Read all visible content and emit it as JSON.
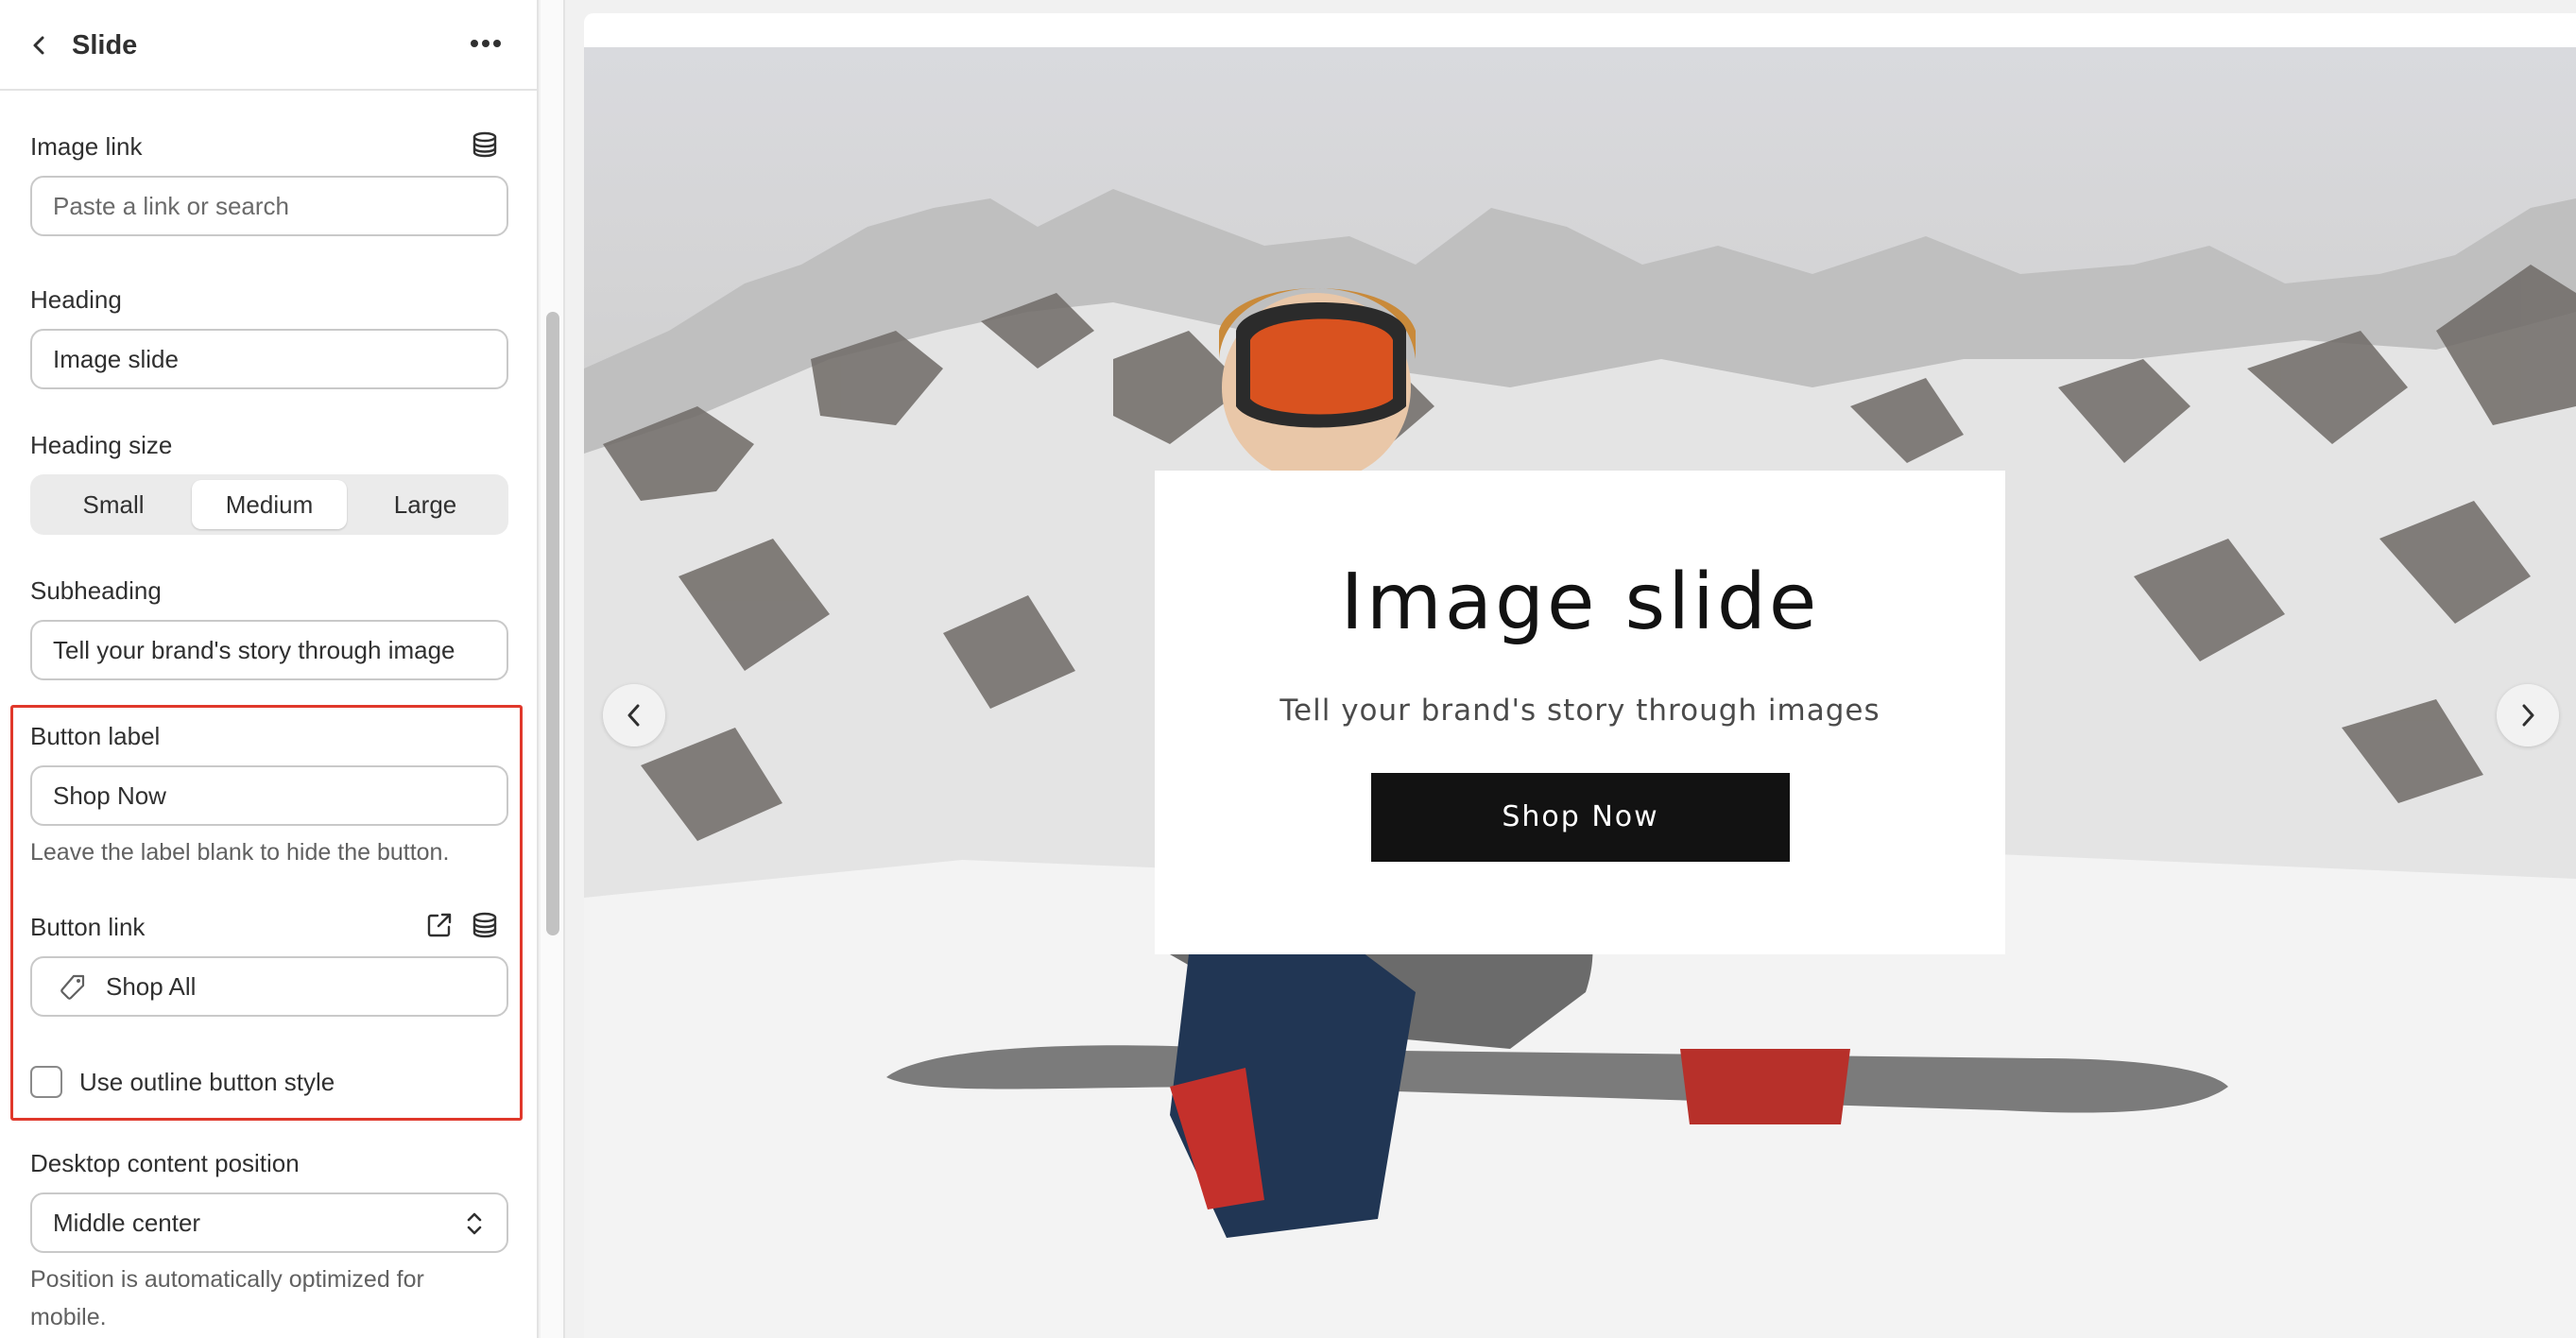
{
  "sidebar": {
    "title": "Slide",
    "image_link": {
      "label": "Image link",
      "placeholder": "Paste a link or search"
    },
    "heading": {
      "label": "Heading",
      "value": "Image slide"
    },
    "heading_size": {
      "label": "Heading size",
      "options": [
        "Small",
        "Medium",
        "Large"
      ],
      "selected": "Medium"
    },
    "subheading": {
      "label": "Subheading",
      "value": "Tell your brand's story through image"
    },
    "button_label": {
      "label": "Button label",
      "value": "Shop Now",
      "help": "Leave the label blank to hide the button."
    },
    "button_link": {
      "label": "Button link",
      "value": "Shop All"
    },
    "outline_button": {
      "label": "Use outline button style",
      "checked": false
    },
    "desktop_position": {
      "label": "Desktop content position",
      "value": "Middle center",
      "help_line1": "Position is automatically optimized for",
      "help_line2": "mobile."
    }
  },
  "preview": {
    "heading": "Image slide",
    "subheading": "Tell your brand's story through images",
    "button": "Shop Now"
  },
  "colors": {
    "highlight": "#e0382b",
    "button_bg": "#121212"
  }
}
